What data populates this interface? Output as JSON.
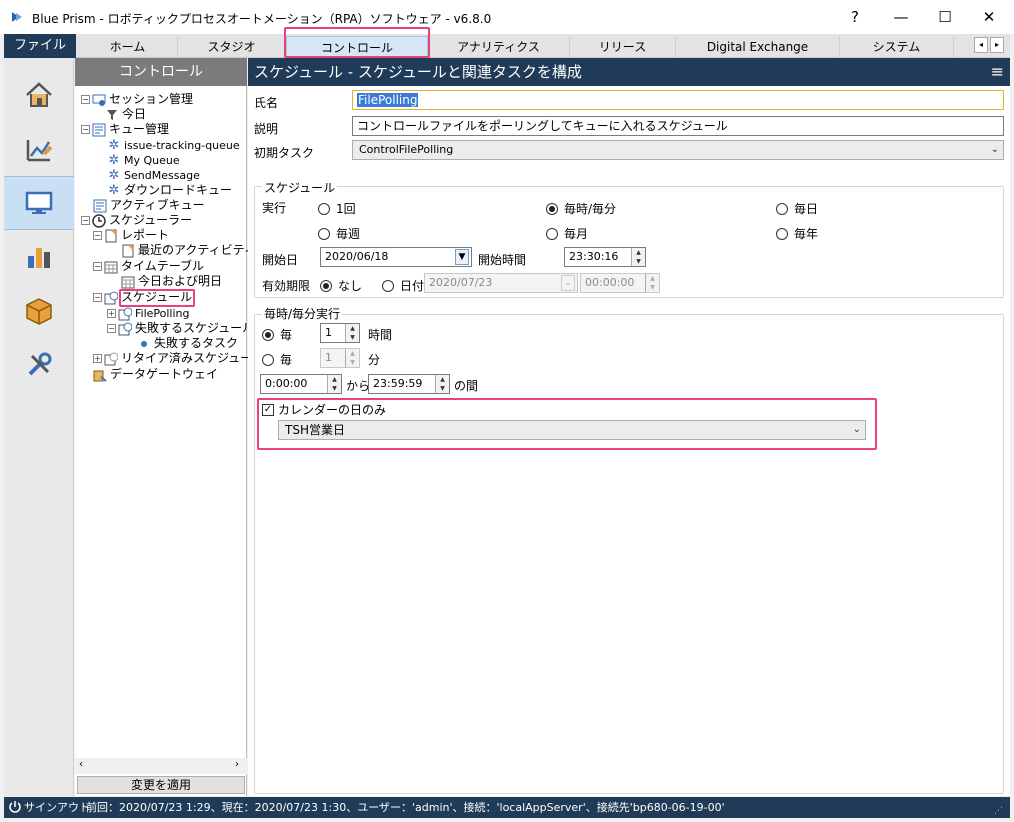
{
  "window": {
    "title": "Blue Prism - ロボティックプロセスオートメーション（RPA）ソフトウェア - v6.8.0",
    "help": "?",
    "minimize": "—",
    "maximize": "☐",
    "close": "✕"
  },
  "menu": {
    "file": "ファイル",
    "tabs": [
      "ホーム",
      "スタジオ",
      "コントロール",
      "アナリティクス",
      "リリース",
      "Digital Exchange",
      "システム"
    ],
    "active_tab": "コントロール",
    "scroll_left": "◂",
    "scroll_right": "▸"
  },
  "rail": {
    "icons": [
      "home-icon",
      "studio-icon",
      "control-icon",
      "analytics-icon",
      "release-icon",
      "system-icon"
    ],
    "active": "control-icon"
  },
  "tree": {
    "header": "コントロール",
    "items": {
      "session_mgmt": "セッション管理",
      "today": "今日",
      "queue_mgmt": "キュー管理",
      "q1": "issue-tracking-queue",
      "q2": "My Queue",
      "q3": "SendMessage",
      "q4": "ダウンロードキュー",
      "active_queue": "アクティブキュー",
      "scheduler": "スケジューラー",
      "report": "レポート",
      "recent_activity": "最近のアクティビティ",
      "timetable": "タイムテーブル",
      "today_tomorrow": "今日および明日",
      "schedule": "スケジュール",
      "filepolling": "FilePolling",
      "failing_schedule": "失敗するスケジュール",
      "failing_task": "失敗するタスク",
      "retired_schedule": "リタイア済みスケジュール",
      "data_gateway": "データゲートウェイ"
    },
    "apply_button": "変更を適用"
  },
  "main": {
    "header": "スケジュール - スケジュールと関連タスクを構成",
    "name_label": "氏名",
    "name_value": "FilePolling",
    "desc_label": "説明",
    "desc_value": "コントロールファイルをポーリングしてキューに入れるスケジュール",
    "initial_task_label": "初期タスク",
    "initial_task_value": "ControlFilePolling",
    "schedule_group": "スケジュール",
    "run_label": "実行",
    "run_options": {
      "once": "1回",
      "hourly": "毎時/毎分",
      "daily": "毎日",
      "weekly": "毎週",
      "monthly": "毎月",
      "yearly": "毎年"
    },
    "run_selected": "hourly",
    "start_date_label": "開始日",
    "start_date_value": "2020/06/18",
    "start_time_label": "開始時間",
    "start_time_value": "23:30:16",
    "expiry_label": "有効期限",
    "expiry_none": "なし",
    "expiry_date": "日付",
    "expiry_date_value": "2020/07/23",
    "expiry_time_value": "00:00:00",
    "hourly_group": "毎時/毎分実行",
    "every_label": "毎",
    "hours_value": "1",
    "hours_unit": "時間",
    "minutes_value": "1",
    "minutes_unit": "分",
    "from_time": "0:00:00",
    "from_label": "から",
    "to_time": "23:59:59",
    "between_label": "の間",
    "calendar_only": "カレンダーの日のみ",
    "calendar_value": "TSH営業日"
  },
  "status": {
    "signout": "サインアウト",
    "info": "前回：2020/07/23 1:29、現在：2020/07/23 1:30、ユーザー：'admin'、接続：'localAppServer'、接続先'bp680-06-19-00'"
  },
  "colors": {
    "accent_navy": "#1f3b57",
    "highlight_pink": "#e7437a",
    "active_tab_blue": "#d6e6f5"
  }
}
